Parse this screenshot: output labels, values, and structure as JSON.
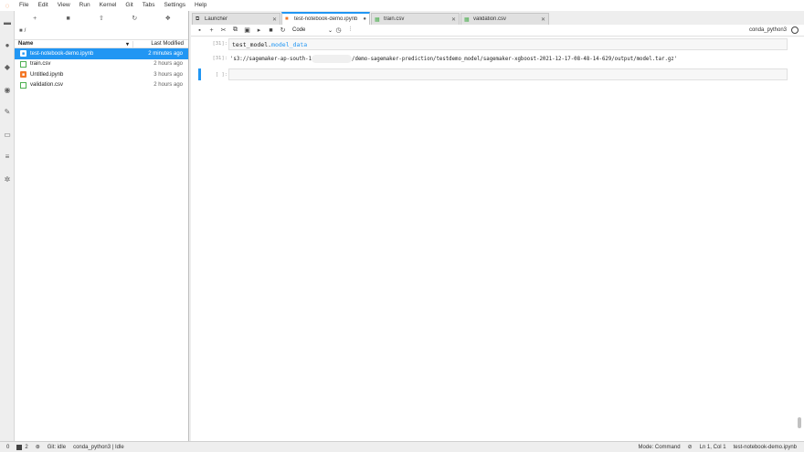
{
  "menu": [
    "File",
    "Edit",
    "View",
    "Run",
    "Kernel",
    "Git",
    "Tabs",
    "Settings",
    "Help"
  ],
  "filebrowser": {
    "breadcrumb": "/",
    "columns": {
      "name": "Name",
      "modified": "Last Modified"
    },
    "files": [
      {
        "name": "test-notebook-demo.ipynb",
        "modified": "2 minutes ago",
        "type": "notebook",
        "selected": true
      },
      {
        "name": "train.csv",
        "modified": "2 hours ago",
        "type": "csv",
        "selected": false
      },
      {
        "name": "Untitled.ipynb",
        "modified": "3 hours ago",
        "type": "notebook",
        "selected": false
      },
      {
        "name": "validation.csv",
        "modified": "2 hours ago",
        "type": "csv",
        "selected": false
      }
    ]
  },
  "tabs": [
    {
      "label": "Launcher",
      "active": false,
      "close": "✕"
    },
    {
      "label": "test-notebook-demo.ipynb",
      "active": true,
      "close": "●"
    },
    {
      "label": "train.csv",
      "active": false,
      "close": "✕"
    },
    {
      "label": "validation.csv",
      "active": false,
      "close": "✕"
    }
  ],
  "notebook": {
    "cell_type": "Code",
    "kernel": "conda_python3",
    "cells": [
      {
        "prompt": "[31]:",
        "code_obj": "test_model.",
        "code_attr": "model_data"
      },
      {
        "output_prompt": "[31]:",
        "output_prefix": "'s3://sagemaker-ap-south-1",
        "output_suffix": "/demo-sagemaker-prediction/testdemo_model/sagemaker-xgboost-2021-12-17-08-48-14-629/output/model.tar.gz'"
      },
      {
        "prompt": "[ ]:"
      }
    ]
  },
  "status": {
    "count_a": "0",
    "count_b": "2",
    "git": "Git: idle",
    "kernel_status": "conda_python3 | Idle",
    "mode": "Mode: Command",
    "position": "Ln 1, Col 1",
    "filename": "test-notebook-demo.ipynb"
  },
  "colors": {
    "accent": "#2196f3",
    "notebook_orange": "#f37726",
    "csv_green": "#4caf50"
  }
}
